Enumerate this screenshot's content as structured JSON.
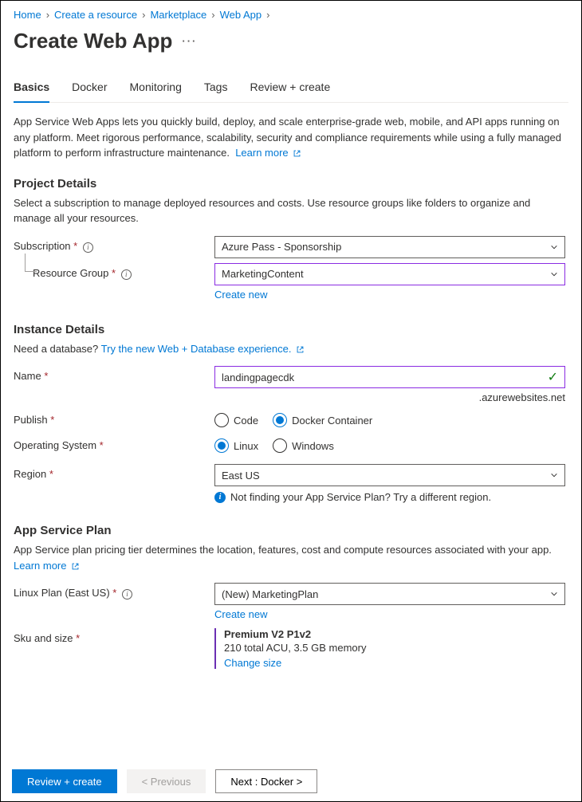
{
  "breadcrumb": [
    "Home",
    "Create a resource",
    "Marketplace",
    "Web App"
  ],
  "page_title": "Create Web App",
  "tabs": [
    "Basics",
    "Docker",
    "Monitoring",
    "Tags",
    "Review + create"
  ],
  "active_tab": 0,
  "intro": "App Service Web Apps lets you quickly build, deploy, and scale enterprise-grade web, mobile, and API apps running on any platform. Meet rigorous performance, scalability, security and compliance requirements while using a fully managed platform to perform infrastructure maintenance.",
  "learn_more": "Learn more",
  "project_details": {
    "heading": "Project Details",
    "desc": "Select a subscription to manage deployed resources and costs. Use resource groups like folders to organize and manage all your resources.",
    "subscription_label": "Subscription",
    "subscription_value": "Azure Pass - Sponsorship",
    "rg_label": "Resource Group",
    "rg_value": "MarketingContent",
    "create_new": "Create new"
  },
  "instance": {
    "heading": "Instance Details",
    "db_prompt": "Need a database?",
    "db_link": "Try the new Web + Database experience.",
    "name_label": "Name",
    "name_value": "landingpagecdk",
    "name_suffix": ".azurewebsites.net",
    "publish_label": "Publish",
    "publish_options": [
      "Code",
      "Docker Container"
    ],
    "publish_selected": 1,
    "os_label": "Operating System",
    "os_options": [
      "Linux",
      "Windows"
    ],
    "os_selected": 0,
    "region_label": "Region",
    "region_value": "East US",
    "region_hint": "Not finding your App Service Plan? Try a different region."
  },
  "plan": {
    "heading": "App Service Plan",
    "desc": "App Service plan pricing tier determines the location, features, cost and compute resources associated with your app.",
    "learn_more": "Learn more",
    "linux_plan_label": "Linux Plan (East US)",
    "linux_plan_value": "(New) MarketingPlan",
    "create_new": "Create new",
    "sku_label": "Sku and size",
    "sku_title": "Premium V2 P1v2",
    "sku_sub": "210 total ACU, 3.5 GB memory",
    "sku_link": "Change size"
  },
  "footer": {
    "review": "Review + create",
    "prev": "< Previous",
    "next": "Next : Docker >"
  }
}
